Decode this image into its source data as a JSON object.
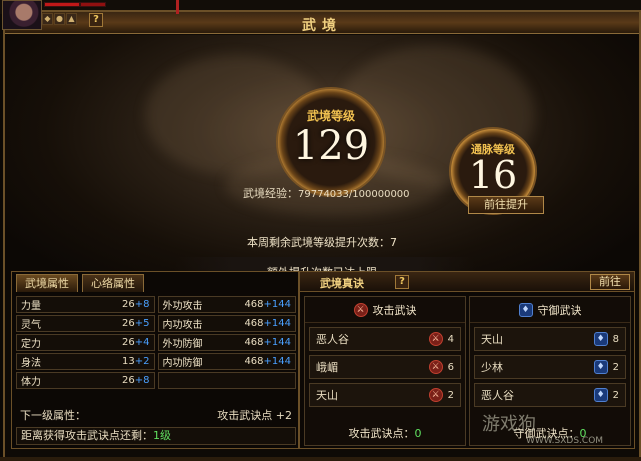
{
  "window": {
    "title": "武境"
  },
  "hud": {
    "help": "?"
  },
  "hero": {
    "level_label": "武境等级",
    "level_value": "129",
    "meridian_label": "通脉等级",
    "meridian_value": "16",
    "exp_label": "武境经验：",
    "exp_value": "79774033/100000000",
    "goto_button": "前往提升",
    "weekly_text": "本周剩余武境等级提升次数：7",
    "limit_text": "额外提升次数已达上限"
  },
  "attributes": {
    "tabs": [
      "武境属性",
      "心络属性"
    ],
    "rows": [
      {
        "left": {
          "name": "力量",
          "value": "26",
          "bonus": "+8"
        },
        "right": {
          "name": "外功攻击",
          "value": "468",
          "bonus": "+144"
        }
      },
      {
        "left": {
          "name": "灵气",
          "value": "26",
          "bonus": "+5"
        },
        "right": {
          "name": "内功攻击",
          "value": "468",
          "bonus": "+144"
        }
      },
      {
        "left": {
          "name": "定力",
          "value": "26",
          "bonus": "+4"
        },
        "right": {
          "name": "外功防御",
          "value": "468",
          "bonus": "+144"
        }
      },
      {
        "left": {
          "name": "身法",
          "value": "13",
          "bonus": "+2"
        },
        "right": {
          "name": "内功防御",
          "value": "468",
          "bonus": "+144"
        }
      },
      {
        "left": {
          "name": "体力",
          "value": "26",
          "bonus": "+8"
        },
        "right": {
          "name": "",
          "value": "",
          "bonus": ""
        }
      }
    ],
    "next_label": "下一级属性：",
    "next_value": "攻击武诀点 +2",
    "distance_label": "距离获得攻击武诀点还剩：",
    "distance_value": "1级"
  },
  "secrets": {
    "title": "武境真诀",
    "help": "?",
    "prev_button": "前往",
    "attack": {
      "title": "攻击武诀",
      "items": [
        {
          "name": "恶人谷",
          "level": "4"
        },
        {
          "name": "峨嵋",
          "level": "6"
        },
        {
          "name": "天山",
          "level": "2"
        }
      ],
      "points_label": "攻击武诀点：",
      "points_value": "0"
    },
    "defense": {
      "title": "守御武诀",
      "items": [
        {
          "name": "天山",
          "level": "8"
        },
        {
          "name": "少林",
          "level": "2"
        },
        {
          "name": "恶人谷",
          "level": "2"
        }
      ],
      "points_label": "守御武诀点：",
      "points_value": "0"
    }
  },
  "watermark": {
    "text": "游戏狗",
    "url": "WWW.SXDS.COM"
  }
}
